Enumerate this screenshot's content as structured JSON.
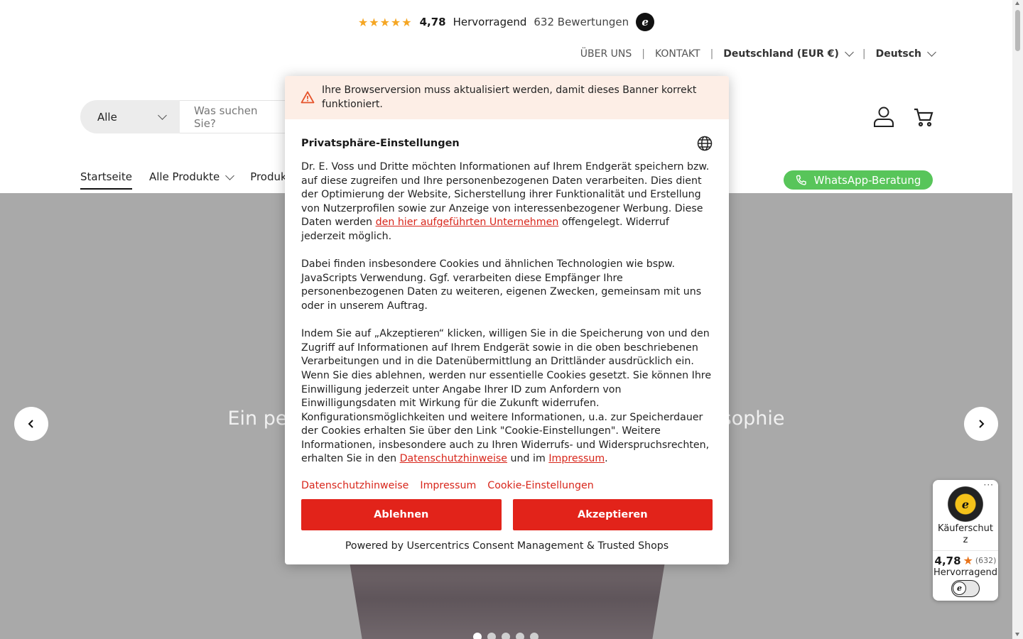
{
  "rating_bar": {
    "stars": "★★★★★",
    "score": "4,78",
    "grade": "Hervorragend",
    "reviews": "632 Bewertungen",
    "logo_letter": "e"
  },
  "utility_nav": {
    "about": "ÜBER UNS",
    "contact": "KONTAKT",
    "region": "Deutschland (EUR €)",
    "language": "Deutsch",
    "separator": "|"
  },
  "search": {
    "category": "Alle",
    "placeholder": "Was suchen Sie?"
  },
  "main_nav": {
    "home": "Startseite",
    "all_products": "Alle Produkte",
    "products_partial": "Produk"
  },
  "whatsapp": {
    "label": "WhatsApp-Beratung"
  },
  "hero": {
    "headline": "Ein per",
    "headline_tail": "sophie",
    "slides_total": 5,
    "active_slide": 1
  },
  "consent": {
    "warning": "Ihre Browserversion muss aktualisiert werden, damit dieses Banner korrekt funktioniert.",
    "title": "Privatsphäre-Einstellungen",
    "p1_before": "Dr. E. Voss und Dritte möchten Informationen auf Ihrem Endgerät speichern bzw. auf diese zugreifen und Ihre personenbezogenen Daten verarbeiten. Dies dient der Optimierung der Website, Sicherstellung ihrer Funktionalität und Erstellung von Nutzerprofilen sowie zur Anzeige von interessenbezogener Werbung. Diese Daten werden ",
    "p1_link": "den hier aufgeführten Unternehmen",
    "p1_after": " offengelegt. Widerruf jederzeit möglich.",
    "p2": "Dabei finden insbesondere Cookies und ähnlichen Technologien wie bspw. JavaScripts Verwendung. Ggf. verarbeiten diese Empfänger Ihre personenbezogenen Daten zu weiteren, eigenen Zwecken, gemeinsam mit uns oder in unserem Auftrag.",
    "p3_before": "Indem Sie auf „Akzeptieren“ klicken, willigen Sie in die Speicherung von und den Zugriff auf Informationen auf Ihrem Endgerät sowie in die oben beschriebenen Verarbeitungen und in die Datenübermittlung an Drittländer ausdrücklich ein. Wenn Sie dies ablehnen, werden nur essentielle Cookies gesetzt. Sie können Ihre Einwilligung jederzeit unter Angabe Ihrer ID zum Anfordern von Einwilligungsdaten mit Wirkung für die Zukunft widerrufen. Konfigurationsmöglichkeiten und weitere Informationen, u.a. zur Speicherdauer der Cookies erhalten Sie über den Link \"Cookie-Einstellungen\". Weitere Informationen, insbesondere auch zu Ihren Widerrufs- und Widerspruchsrechten, erhalten Sie in den ",
    "p3_link1": "Datenschutzhinweise",
    "p3_mid": " und im ",
    "p3_link2": "Impressum",
    "p3_end": ".",
    "links": [
      "Datenschutzhinweise",
      "Impressum",
      "Cookie-Einstellungen"
    ],
    "reject": "Ablehnen",
    "accept": "Akzeptieren",
    "powered_by": "Powered by Usercentrics Consent Management & Trusted Shops"
  },
  "trusted_badge": {
    "menu": "···",
    "label": "Käuferschutz",
    "score": "4,78",
    "count": "(632)",
    "grade": "Hervorragend"
  },
  "colors": {
    "accent_red": "#e2231a",
    "whatsapp_green": "#58c55a",
    "warning_bg": "#fdeee6",
    "star_gold": "#f5a623"
  }
}
